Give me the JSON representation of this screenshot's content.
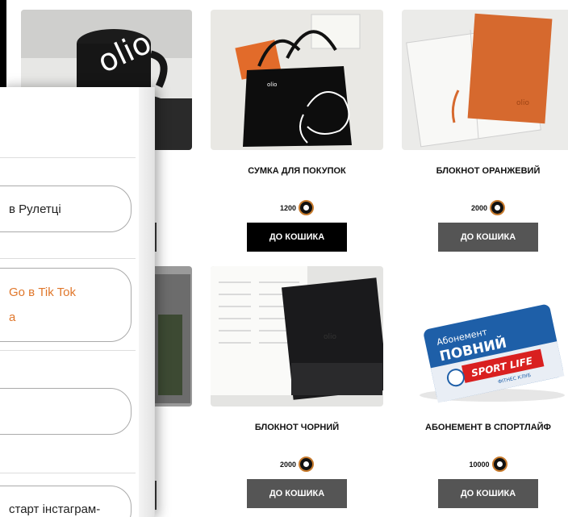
{
  "products": [
    {
      "title": "СУМКА ДЛЯ ПОКУПОК",
      "price": "1200",
      "button": "ДО КОШИКА",
      "button_style": "dark",
      "image": "black-tote-bag"
    },
    {
      "title": "БЛОКНОТ ОРАНЖЕВИЙ",
      "price": "2000",
      "button": "ДО КОШИКА",
      "button_style": "grey",
      "image": "orange-notebook"
    },
    {
      "title": "БЛОКНОТ ЧОРНИЙ",
      "price": "2000",
      "button": "ДО КОШИКА",
      "button_style": "grey",
      "image": "black-notebook"
    },
    {
      "title": "АБОНЕМЕНТ В СПОРТЛАЙФ",
      "price": "10000",
      "button": "ДО КОШИКА",
      "button_style": "grey",
      "image": "sport-life-card"
    }
  ],
  "card_image_text": {
    "abonement": "Абонемент",
    "full": "ПОВНИЙ",
    "brand": "SPORT LIFE",
    "club": "ФІТНЕС КЛУБ"
  },
  "panel": {
    "tasks": [
      {
        "text": "в Рулетці",
        "style": "normal"
      },
      {
        "line1": "Go в Tik Tok",
        "line2": "а",
        "style": "orange"
      },
      {
        "text": "",
        "style": "normal"
      },
      {
        "text": "старт інстаграм-",
        "style": "normal"
      }
    ]
  },
  "colors": {
    "accent": "#e0772b",
    "button_dark": "#000000",
    "button_grey": "#555555",
    "coin_ring": "#c77a2c"
  }
}
